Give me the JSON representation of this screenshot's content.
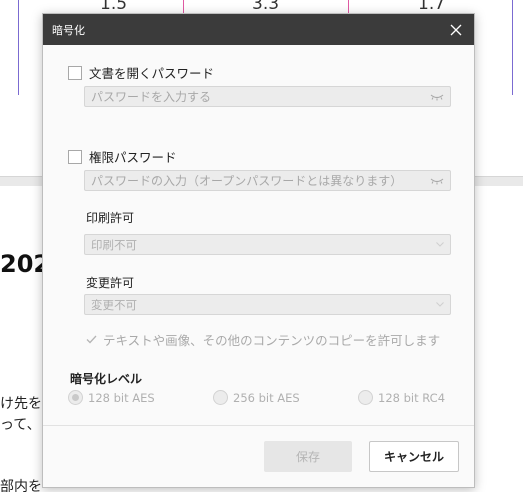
{
  "background": {
    "numbers": [
      "1.5",
      "3.3",
      "1.7"
    ],
    "heading_fragment": "202",
    "lines": [
      "け先を指",
      "って、こ",
      "部内を"
    ]
  },
  "dialog": {
    "title": "暗号化",
    "open_password": {
      "label": "文書を開くパスワード",
      "placeholder": "パスワードを入力する"
    },
    "permission_password": {
      "label": "権限パスワード",
      "placeholder": "パスワードの入力（オープンパスワードとは異なります）"
    },
    "print_permission": {
      "label": "印刷許可",
      "value": "印刷不可"
    },
    "change_permission": {
      "label": "変更許可",
      "value": "変更不可"
    },
    "copy_permission_label": "テキストや画像、その他のコンテンツのコピーを許可します",
    "encryption_level": {
      "title": "暗号化レベル",
      "options": [
        "128 bit AES",
        "256 bit AES",
        "128 bit RC4"
      ],
      "selected": "128 bit AES"
    },
    "buttons": {
      "save": "保存",
      "cancel": "キャンセル"
    }
  },
  "colors": {
    "titlebar": "#3b3b3b",
    "dialog_bg": "#fafafa",
    "disabled_bg": "#ececec",
    "disabled_text": "#a8a8a8",
    "accent_purple": "#7b6bd1",
    "accent_pink": "#e05aa3"
  }
}
